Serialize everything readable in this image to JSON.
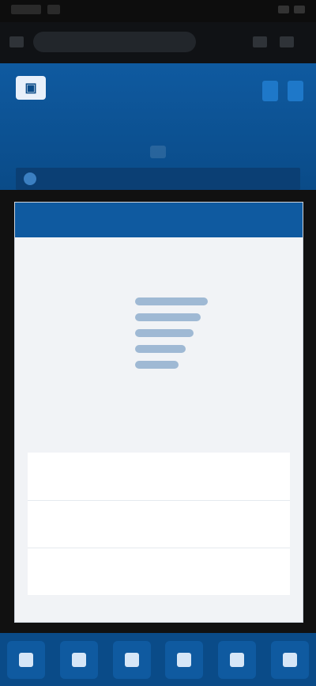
{
  "status_bar": {},
  "address_bar": {
    "url": ""
  },
  "header": {
    "logo_text": "",
    "actions": [
      "",
      ""
    ]
  },
  "nav": {
    "items": [
      "",
      "",
      ""
    ],
    "selected_index": 1
  },
  "subbar": {
    "label": ""
  },
  "content": {
    "section_title": "",
    "card_title": "",
    "table_title": "",
    "rows": [
      {
        "left": "",
        "right": [
          "",
          ""
        ]
      },
      {
        "left": "",
        "right": [
          "",
          ""
        ]
      },
      {
        "left": "",
        "right": [
          "",
          ""
        ]
      }
    ]
  },
  "bottom_nav": {
    "items": [
      "",
      "",
      "",
      "",
      "",
      ""
    ]
  }
}
